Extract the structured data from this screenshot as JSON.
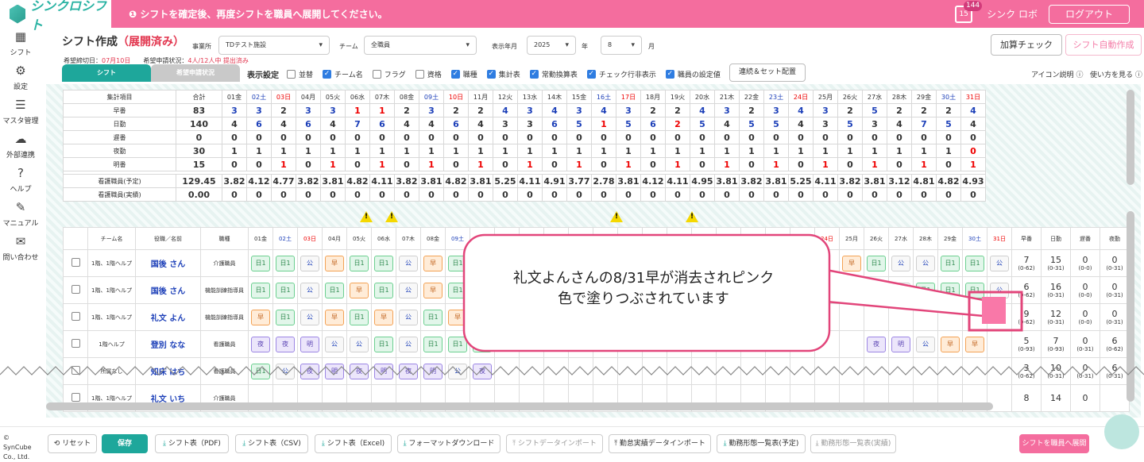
{
  "brand": {
    "logo_text": "シンクロシフト"
  },
  "notice": {
    "text": "シフトを確定後、再度シフトを職員へ展開してください。"
  },
  "user": {
    "calendar_day": "15",
    "badge": "144",
    "name": "シンク ロボ",
    "logout_label": "ログアウト"
  },
  "sidebar": {
    "items": [
      {
        "label": "シフト",
        "icon": "calendar-icon"
      },
      {
        "label": "設定",
        "icon": "gear-icon"
      },
      {
        "label": "マスタ管理",
        "icon": "database-icon"
      },
      {
        "label": "外部連携",
        "icon": "cloud-icon"
      },
      {
        "label": "ヘルプ",
        "icon": "question-icon"
      },
      {
        "label": "マニュアル",
        "icon": "edit-icon"
      },
      {
        "label": "問い合わせ",
        "icon": "mail-icon"
      }
    ]
  },
  "page": {
    "title": "シフト作成",
    "status": "（展開済み）",
    "deadline_label": "希望締切日：",
    "deadline_value": "07月10日",
    "request_label": "希望申請状況：",
    "request_value": "4人/12人中 提出済み"
  },
  "filters": {
    "office_label": "事業所",
    "office_value": "TDテスト施設",
    "team_label": "チーム",
    "team_value": "全職員",
    "month_label": "表示年月",
    "year_value": "2025",
    "year_unit": "年",
    "month_value": "8",
    "month_unit": "月"
  },
  "actions": {
    "check": "加算チェック",
    "auto": "シフト自動作成",
    "series": "連続＆セット配置"
  },
  "tabs": {
    "shift": "シフト",
    "request": "希望申請状況"
  },
  "display": {
    "label": "表示設定",
    "options": [
      {
        "label": "並替",
        "checked": false
      },
      {
        "label": "チーム名",
        "checked": true
      },
      {
        "label": "フラグ",
        "checked": false
      },
      {
        "label": "資格",
        "checked": false
      },
      {
        "label": "職種",
        "checked": true
      },
      {
        "label": "集計表",
        "checked": true
      },
      {
        "label": "常勤換算表",
        "checked": true
      },
      {
        "label": "チェック行非表示",
        "checked": true
      },
      {
        "label": "職員の設定値",
        "checked": true
      }
    ]
  },
  "help": {
    "icon_desc": "アイコン説明",
    "howto": "使い方を見る"
  },
  "days": [
    "01金",
    "02土",
    "03日",
    "04月",
    "05火",
    "06水",
    "07木",
    "08金",
    "09土",
    "10日",
    "11月",
    "12火",
    "13水",
    "14木",
    "15金",
    "16土",
    "17日",
    "18月",
    "19火",
    "20水",
    "21木",
    "22金",
    "23土",
    "24日",
    "25月",
    "26火",
    "27水",
    "28木",
    "29金",
    "30土",
    "31日"
  ],
  "summary": {
    "headers": {
      "item": "集計項目",
      "total": "合計"
    },
    "rows": [
      {
        "label": "早番",
        "total": "83",
        "vals": [
          "3",
          "3",
          "2",
          "3",
          "3",
          "1",
          "1",
          "2",
          "3",
          "2",
          "2",
          "4",
          "3",
          "4",
          "3",
          "4",
          "3",
          "2",
          "2",
          "4",
          "3",
          "2",
          "3",
          "4",
          "3",
          "2",
          "5",
          "2",
          "2",
          "2",
          "4"
        ]
      },
      {
        "label": "日勤",
        "total": "140",
        "vals": [
          "4",
          "6",
          "4",
          "6",
          "4",
          "7",
          "6",
          "4",
          "4",
          "6",
          "4",
          "3",
          "3",
          "6",
          "5",
          "1",
          "5",
          "6",
          "2",
          "5",
          "4",
          "5",
          "5",
          "4",
          "3",
          "5",
          "3",
          "4",
          "7",
          "5",
          "4"
        ]
      },
      {
        "label": "遅番",
        "total": "0",
        "vals": [
          "0",
          "0",
          "0",
          "0",
          "0",
          "0",
          "0",
          "0",
          "0",
          "0",
          "0",
          "0",
          "0",
          "0",
          "0",
          "0",
          "0",
          "0",
          "0",
          "0",
          "0",
          "0",
          "0",
          "0",
          "0",
          "0",
          "0",
          "0",
          "0",
          "0",
          "0"
        ]
      },
      {
        "label": "夜勤",
        "total": "30",
        "vals": [
          "1",
          "1",
          "1",
          "1",
          "1",
          "1",
          "1",
          "1",
          "1",
          "1",
          "1",
          "1",
          "1",
          "1",
          "1",
          "1",
          "1",
          "1",
          "1",
          "1",
          "1",
          "1",
          "1",
          "1",
          "1",
          "1",
          "1",
          "1",
          "1",
          "1",
          "0"
        ]
      },
      {
        "label": "明番",
        "total": "15",
        "vals": [
          "0",
          "0",
          "1",
          "0",
          "1",
          "0",
          "1",
          "0",
          "1",
          "0",
          "1",
          "0",
          "1",
          "0",
          "1",
          "0",
          "1",
          "0",
          "1",
          "0",
          "1",
          "0",
          "1",
          "0",
          "1",
          "0",
          "1",
          "0",
          "1",
          "0",
          "1"
        ]
      }
    ],
    "fte": [
      {
        "label": "看護職員(予定)",
        "total": "129.45",
        "vals": [
          "3.82",
          "4.12",
          "4.77",
          "3.82",
          "3.81",
          "4.82",
          "4.11",
          "3.82",
          "3.81",
          "4.82",
          "3.81",
          "5.25",
          "4.11",
          "4.91",
          "3.77",
          "2.78",
          "3.81",
          "4.12",
          "4.11",
          "4.95",
          "3.81",
          "3.82",
          "3.81",
          "5.25",
          "4.11",
          "3.82",
          "3.81",
          "3.12",
          "4.81",
          "4.82",
          "4.93"
        ]
      },
      {
        "label": "看護職員(実績)",
        "total": "0.00",
        "vals": [
          "0",
          "0",
          "0",
          "0",
          "0",
          "0",
          "0",
          "0",
          "0",
          "0",
          "0",
          "0",
          "0",
          "0",
          "0",
          "0",
          "0",
          "0",
          "0",
          "0",
          "0",
          "0",
          "0",
          "0",
          "0",
          "0",
          "0",
          "0",
          "0",
          "0",
          "0"
        ]
      }
    ]
  },
  "staff": {
    "headers": {
      "team": "チーム名",
      "role_name": "役職／名前",
      "job": "職種",
      "early": "早番",
      "day": "日勤",
      "late": "遅番",
      "night": "夜勤"
    },
    "rows": [
      {
        "team": "1階、1階ヘルプ",
        "name": "国後 さん",
        "job": "介護職員",
        "shifts": [
          "日1",
          "日1",
          "公",
          "早",
          "日1",
          "日1",
          "公",
          "早",
          "日1",
          "早",
          "",
          "",
          "",
          "",
          "",
          "",
          "",
          "",
          "",
          "",
          "",
          "",
          "",
          "",
          "早",
          "日1",
          "公",
          "公",
          "日1",
          "日1",
          "公"
        ],
        "early": "7",
        "early_r": "(0-62)",
        "day": "15",
        "day_r": "(0-31)",
        "late": "0",
        "late_r": "(0-0)",
        "night": "0",
        "night_r": "(0-31)"
      },
      {
        "team": "1階、1階ヘルプ",
        "name": "国後 さん",
        "job": "機能訓練指導員",
        "shifts": [
          "日1",
          "日1",
          "公",
          "日1",
          "早",
          "日1",
          "公",
          "早",
          "日1",
          "日1",
          "",
          "",
          "",
          "",
          "",
          "",
          "",
          "",
          "",
          "",
          "",
          "",
          "",
          "",
          "早",
          "日1",
          "公",
          "日1",
          "日1",
          "日1",
          "公"
        ],
        "early": "6",
        "early_r": "(0-62)",
        "day": "16",
        "day_r": "(0-31)",
        "late": "0",
        "late_r": "(0-0)",
        "night": "0",
        "night_r": "(0-31)"
      },
      {
        "team": "1階、1階ヘルプ",
        "name": "礼文 よん",
        "job": "機能訓練指導員",
        "shifts": [
          "早",
          "日1",
          "公",
          "早",
          "日1",
          "早",
          "公",
          "日1",
          "早",
          "公",
          "",
          "",
          "",
          "",
          "",
          "",
          "",
          "",
          "",
          "",
          "",
          "",
          "",
          "",
          "",
          "",
          "",
          "",
          "",
          "",
          ""
        ],
        "early": "9",
        "early_r": "(0-62)",
        "day": "12",
        "day_r": "(0-31)",
        "late": "0",
        "late_r": "(0-0)",
        "night": "0",
        "night_r": "(0-31)"
      },
      {
        "team": "1階ヘルプ",
        "name": "登別 なな",
        "job": "看護職員",
        "shifts": [
          "夜",
          "夜",
          "明",
          "公",
          "公",
          "日1",
          "公",
          "日1",
          "日1",
          "日1",
          "",
          "",
          "",
          "",
          "",
          "",
          "",
          "",
          "",
          "",
          "",
          "",
          "",
          "",
          "",
          "夜",
          "明",
          "公",
          "早",
          "早",
          ""
        ],
        "early": "5",
        "early_r": "(0-93)",
        "day": "7",
        "day_r": "(0-93)",
        "late": "0",
        "late_r": "(0-31)",
        "night": "6",
        "night_r": "(0-62)"
      },
      {
        "team": "所属なし",
        "name": "知床 はち",
        "job": "看護職員",
        "shifts": [
          "日1",
          "公",
          "夜",
          "明",
          "夜",
          "明",
          "夜",
          "明",
          "公",
          "夜",
          "",
          "",
          "",
          "",
          "",
          "",
          "",
          "",
          "",
          "",
          "",
          "",
          "",
          "",
          "",
          "",
          "",
          "",
          "",
          "",
          ""
        ],
        "early": "3",
        "early_r": "(0-62)",
        "day": "10",
        "day_r": "(0-31)",
        "late": "0",
        "late_r": "(0-31)",
        "night": "6",
        "night_r": "(0-31)"
      },
      {
        "team": "1階、1階ヘルプ",
        "name": "礼文 いち",
        "job": "介護職員",
        "shifts": [
          "",
          "",
          "",
          "",
          "",
          "",
          "",
          "",
          "",
          "",
          "",
          "",
          "",
          "",
          "",
          "",
          "",
          "",
          "",
          "",
          "",
          "",
          "",
          "",
          "",
          "",
          "",
          "",
          "",
          "",
          ""
        ],
        "early": "8",
        "early_r": "",
        "day": "14",
        "day_r": "",
        "late": "0",
        "late_r": "",
        "night": "",
        "night_r": ""
      }
    ]
  },
  "callout": {
    "text_line1": "礼文よんさんの8/31早が消去されピンク",
    "text_line2": "色で塗りつぶされています"
  },
  "bottom": {
    "copyright": "© SynCube Co., Ltd.",
    "reset": "リセット",
    "save": "保存",
    "pdf": "シフト表（PDF)",
    "csv": "シフト表（CSV)",
    "excel": "シフト表（Excel)",
    "format": "フォーマットダウンロード",
    "import": "シフトデータインポート",
    "attendance": "勤怠実績データインポート",
    "list_plan": "勤務形態一覧表(予定)",
    "list_actual": "勤務形態一覧表(実績)",
    "deploy": "シフトを職員へ展開"
  }
}
